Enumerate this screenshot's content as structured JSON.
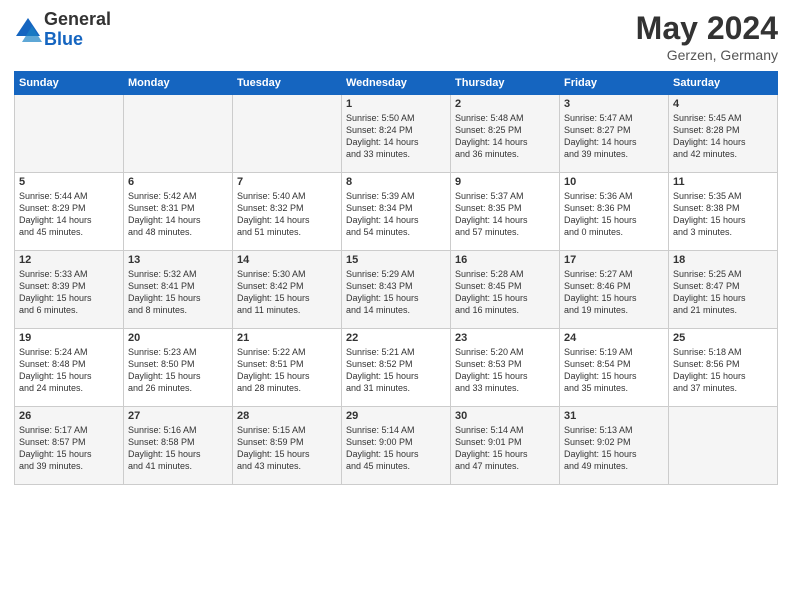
{
  "header": {
    "logo_general": "General",
    "logo_blue": "Blue",
    "title": "May 2024",
    "location": "Gerzen, Germany"
  },
  "weekdays": [
    "Sunday",
    "Monday",
    "Tuesday",
    "Wednesday",
    "Thursday",
    "Friday",
    "Saturday"
  ],
  "rows": [
    [
      {
        "day": "",
        "lines": []
      },
      {
        "day": "",
        "lines": []
      },
      {
        "day": "",
        "lines": []
      },
      {
        "day": "1",
        "lines": [
          "Sunrise: 5:50 AM",
          "Sunset: 8:24 PM",
          "Daylight: 14 hours",
          "and 33 minutes."
        ]
      },
      {
        "day": "2",
        "lines": [
          "Sunrise: 5:48 AM",
          "Sunset: 8:25 PM",
          "Daylight: 14 hours",
          "and 36 minutes."
        ]
      },
      {
        "day": "3",
        "lines": [
          "Sunrise: 5:47 AM",
          "Sunset: 8:27 PM",
          "Daylight: 14 hours",
          "and 39 minutes."
        ]
      },
      {
        "day": "4",
        "lines": [
          "Sunrise: 5:45 AM",
          "Sunset: 8:28 PM",
          "Daylight: 14 hours",
          "and 42 minutes."
        ]
      }
    ],
    [
      {
        "day": "5",
        "lines": [
          "Sunrise: 5:44 AM",
          "Sunset: 8:29 PM",
          "Daylight: 14 hours",
          "and 45 minutes."
        ]
      },
      {
        "day": "6",
        "lines": [
          "Sunrise: 5:42 AM",
          "Sunset: 8:31 PM",
          "Daylight: 14 hours",
          "and 48 minutes."
        ]
      },
      {
        "day": "7",
        "lines": [
          "Sunrise: 5:40 AM",
          "Sunset: 8:32 PM",
          "Daylight: 14 hours",
          "and 51 minutes."
        ]
      },
      {
        "day": "8",
        "lines": [
          "Sunrise: 5:39 AM",
          "Sunset: 8:34 PM",
          "Daylight: 14 hours",
          "and 54 minutes."
        ]
      },
      {
        "day": "9",
        "lines": [
          "Sunrise: 5:37 AM",
          "Sunset: 8:35 PM",
          "Daylight: 14 hours",
          "and 57 minutes."
        ]
      },
      {
        "day": "10",
        "lines": [
          "Sunrise: 5:36 AM",
          "Sunset: 8:36 PM",
          "Daylight: 15 hours",
          "and 0 minutes."
        ]
      },
      {
        "day": "11",
        "lines": [
          "Sunrise: 5:35 AM",
          "Sunset: 8:38 PM",
          "Daylight: 15 hours",
          "and 3 minutes."
        ]
      }
    ],
    [
      {
        "day": "12",
        "lines": [
          "Sunrise: 5:33 AM",
          "Sunset: 8:39 PM",
          "Daylight: 15 hours",
          "and 6 minutes."
        ]
      },
      {
        "day": "13",
        "lines": [
          "Sunrise: 5:32 AM",
          "Sunset: 8:41 PM",
          "Daylight: 15 hours",
          "and 8 minutes."
        ]
      },
      {
        "day": "14",
        "lines": [
          "Sunrise: 5:30 AM",
          "Sunset: 8:42 PM",
          "Daylight: 15 hours",
          "and 11 minutes."
        ]
      },
      {
        "day": "15",
        "lines": [
          "Sunrise: 5:29 AM",
          "Sunset: 8:43 PM",
          "Daylight: 15 hours",
          "and 14 minutes."
        ]
      },
      {
        "day": "16",
        "lines": [
          "Sunrise: 5:28 AM",
          "Sunset: 8:45 PM",
          "Daylight: 15 hours",
          "and 16 minutes."
        ]
      },
      {
        "day": "17",
        "lines": [
          "Sunrise: 5:27 AM",
          "Sunset: 8:46 PM",
          "Daylight: 15 hours",
          "and 19 minutes."
        ]
      },
      {
        "day": "18",
        "lines": [
          "Sunrise: 5:25 AM",
          "Sunset: 8:47 PM",
          "Daylight: 15 hours",
          "and 21 minutes."
        ]
      }
    ],
    [
      {
        "day": "19",
        "lines": [
          "Sunrise: 5:24 AM",
          "Sunset: 8:48 PM",
          "Daylight: 15 hours",
          "and 24 minutes."
        ]
      },
      {
        "day": "20",
        "lines": [
          "Sunrise: 5:23 AM",
          "Sunset: 8:50 PM",
          "Daylight: 15 hours",
          "and 26 minutes."
        ]
      },
      {
        "day": "21",
        "lines": [
          "Sunrise: 5:22 AM",
          "Sunset: 8:51 PM",
          "Daylight: 15 hours",
          "and 28 minutes."
        ]
      },
      {
        "day": "22",
        "lines": [
          "Sunrise: 5:21 AM",
          "Sunset: 8:52 PM",
          "Daylight: 15 hours",
          "and 31 minutes."
        ]
      },
      {
        "day": "23",
        "lines": [
          "Sunrise: 5:20 AM",
          "Sunset: 8:53 PM",
          "Daylight: 15 hours",
          "and 33 minutes."
        ]
      },
      {
        "day": "24",
        "lines": [
          "Sunrise: 5:19 AM",
          "Sunset: 8:54 PM",
          "Daylight: 15 hours",
          "and 35 minutes."
        ]
      },
      {
        "day": "25",
        "lines": [
          "Sunrise: 5:18 AM",
          "Sunset: 8:56 PM",
          "Daylight: 15 hours",
          "and 37 minutes."
        ]
      }
    ],
    [
      {
        "day": "26",
        "lines": [
          "Sunrise: 5:17 AM",
          "Sunset: 8:57 PM",
          "Daylight: 15 hours",
          "and 39 minutes."
        ]
      },
      {
        "day": "27",
        "lines": [
          "Sunrise: 5:16 AM",
          "Sunset: 8:58 PM",
          "Daylight: 15 hours",
          "and 41 minutes."
        ]
      },
      {
        "day": "28",
        "lines": [
          "Sunrise: 5:15 AM",
          "Sunset: 8:59 PM",
          "Daylight: 15 hours",
          "and 43 minutes."
        ]
      },
      {
        "day": "29",
        "lines": [
          "Sunrise: 5:14 AM",
          "Sunset: 9:00 PM",
          "Daylight: 15 hours",
          "and 45 minutes."
        ]
      },
      {
        "day": "30",
        "lines": [
          "Sunrise: 5:14 AM",
          "Sunset: 9:01 PM",
          "Daylight: 15 hours",
          "and 47 minutes."
        ]
      },
      {
        "day": "31",
        "lines": [
          "Sunrise: 5:13 AM",
          "Sunset: 9:02 PM",
          "Daylight: 15 hours",
          "and 49 minutes."
        ]
      },
      {
        "day": "",
        "lines": []
      }
    ]
  ]
}
